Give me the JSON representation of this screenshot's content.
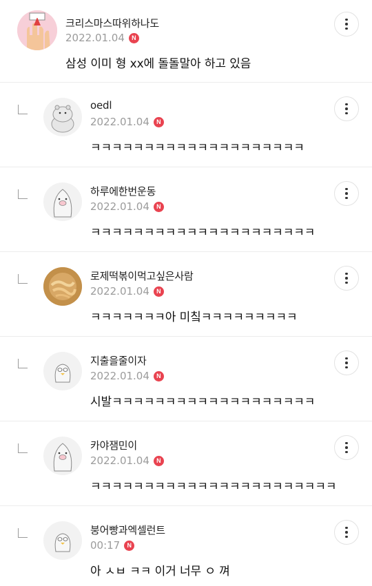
{
  "comments": [
    {
      "nick": "크리스마스따위하나도",
      "date": "2022.01.04",
      "badge": "N",
      "text": "삼성 이미 형 xx에 돌돌말아 하고 있음",
      "avatar": "christmas-avatar"
    },
    {
      "nick": "oedl",
      "date": "2022.01.04",
      "badge": "N",
      "text": "ㅋㅋㅋㅋㅋㅋㅋㅋㅋㅋㅋㅋㅋㅋㅋㅋㅋㅋㅋㅋ",
      "avatar": "hippo-avatar"
    },
    {
      "nick": "하루에한번운동",
      "date": "2022.01.04",
      "badge": "N",
      "text": "ㅋㅋㅋㅋㅋㅋㅋㅋㅋㅋㅋㅋㅋㅋㅋㅋㅋㅋㅋㅋㅋ",
      "avatar": "penguin-avatar"
    },
    {
      "nick": "로제떡볶이먹고싶은사람",
      "date": "2022.01.04",
      "badge": "N",
      "text": "ㅋㅋㅋㅋㅋㅋㅋ아 미칰ㅋㅋㅋㅋㅋㅋㅋㅋㅋ",
      "avatar": "tteokbokki-avatar"
    },
    {
      "nick": "지출을줄이자",
      "date": "2022.01.04",
      "badge": "N",
      "text": "시발ㅋㅋㅋㅋㅋㅋㅋㅋㅋㅋㅋㅋㅋㅋㅋㅋㅋㅋㅋ",
      "avatar": "bird-avatar"
    },
    {
      "nick": "카야잼민이",
      "date": "2022.01.04",
      "badge": "N",
      "text": "ㅋㅋㅋㅋㅋㅋㅋㅋㅋㅋㅋㅋㅋㅋㅋㅋㅋㅋㅋㅋㅋㅋㅋ",
      "avatar": "penguin-avatar"
    },
    {
      "nick": "붕어빵과엑셀런트",
      "date": "00:17",
      "badge": "N",
      "text": "아 ㅅㅂ ㅋㅋ 이거 너무 ㅇ 껴",
      "avatar": "bird-avatar"
    }
  ],
  "colors": {
    "badge": "#e94350",
    "date": "#9b9b9b",
    "divider": "#ececec"
  }
}
